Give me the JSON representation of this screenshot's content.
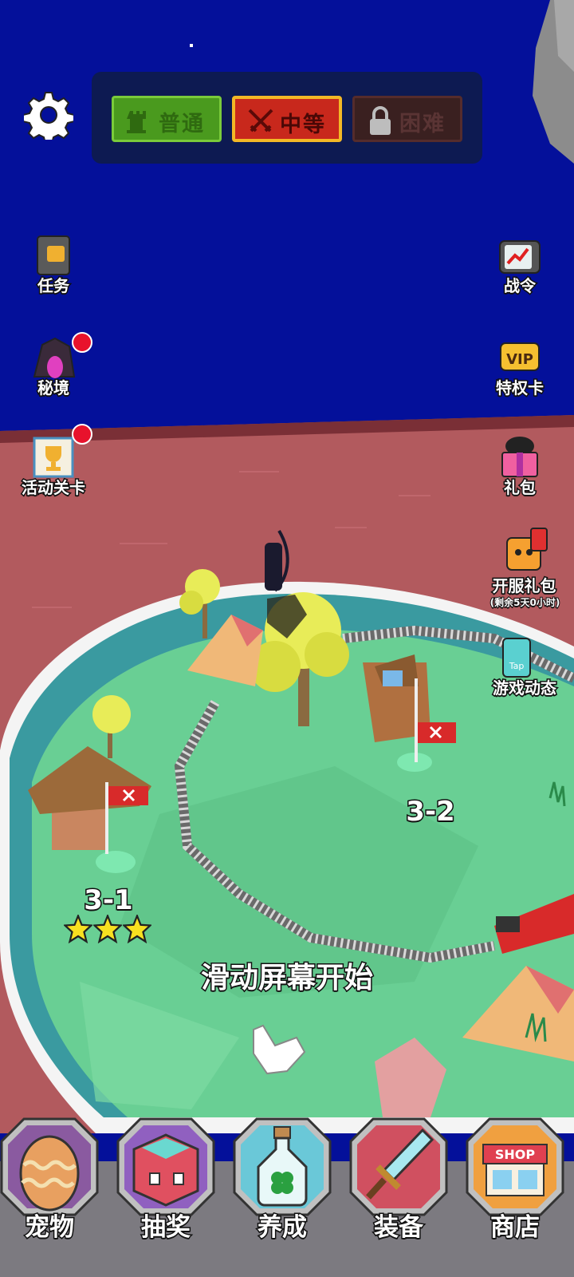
{
  "difficulty": {
    "normal_label": "普通",
    "medium_label": "中等",
    "hard_label": "困难",
    "selected": "中等"
  },
  "left_menu": {
    "tasks_label": "任务",
    "secret_realm_label": "秘境",
    "event_stage_label": "活动关卡"
  },
  "right_menu": {
    "battle_pass_label": "战令",
    "vip_badge": "VIP",
    "vip_label": "特权卡",
    "gift_pack_label": "礼包",
    "launch_pack_label": "开服礼包",
    "launch_pack_timer": "(剩余5天0小时)",
    "game_news_label": "游戏动态",
    "tap_text": "Tap"
  },
  "levels": {
    "level_1": "3-1",
    "level_1_stars": 3,
    "level_2": "3-2"
  },
  "hint": "滑动屏幕开始",
  "bottom_nav": {
    "pet": "宠物",
    "lottery": "抽奖",
    "cultivate": "养成",
    "equipment": "装备",
    "shop": "商店",
    "shop_sign": "SHOP"
  },
  "colors": {
    "sky": "#04109a",
    "sea": "#b25a5e",
    "grass": "#69cf94",
    "normal_btn": "#4a9a1e",
    "medium_btn": "#c8281c",
    "hard_btn": "#3a2020",
    "notify_dot": "#e8122c"
  }
}
